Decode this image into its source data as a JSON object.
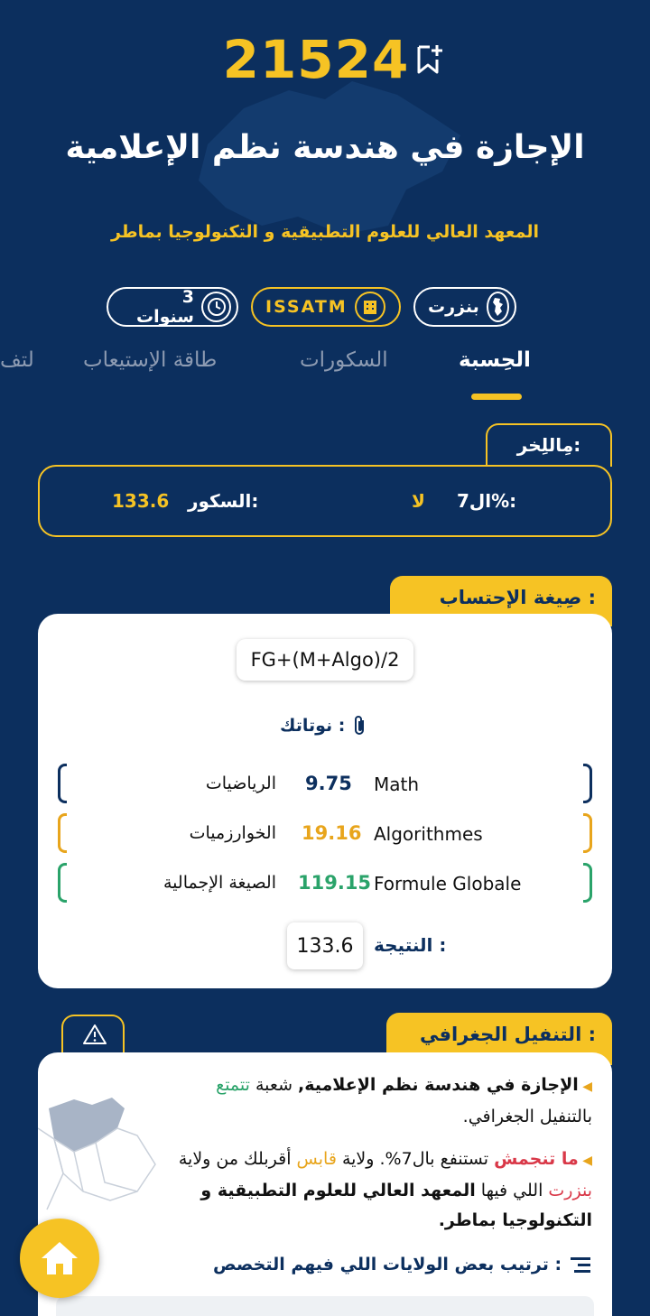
{
  "header": {
    "code": "21524",
    "title": "الإجازة في هندسة نظم الإعلامية",
    "institution": "المعهد العالي للعلوم التطبيقية و التكنولوجيا بماطر",
    "chips": {
      "governorate": "بنزرت",
      "institution_short": "ISSATM",
      "duration": "3 سنوات"
    }
  },
  "tabs": [
    "الحِسبة",
    "السكورات",
    "طاقة الإستيعاب",
    "التف"
  ],
  "filter": {
    "tag": "مِاللِخر:",
    "percent_label": "ال7%:",
    "percent_value": "لا",
    "score_label": "السكور:",
    "score_value": "133.6"
  },
  "formula": {
    "tag": "صِيغة الإحتساب :",
    "expression": "FG+(M+Algo)/2",
    "notes_label": "نوتاتك :",
    "rows": [
      {
        "fr": "Math",
        "value": "9.75",
        "ar": "الرياضيات",
        "color": "#0c2f5e"
      },
      {
        "fr": "Algorithmes",
        "value": "19.16",
        "ar": "الخوارزميات",
        "color": "#e8a51c"
      },
      {
        "fr": "Formule Globale",
        "value": "119.15",
        "ar": "الصيغة الإجمالية",
        "color": "#2aa36a"
      }
    ],
    "result_label": "النتيجة :",
    "result_value": "133.6"
  },
  "geo": {
    "tag": "التنفيل الجغرافي :",
    "p1_bold": "الإجازة في هندسة نظم الإعلامية,",
    "p1_mid": " شعبة ",
    "p1_green": "تتمتع",
    "p1_end": " بالتنفيل الجغرافي.",
    "p2_red": "ما تنجمش",
    "p2_a": " تستنفع بال7%. ولاية ",
    "p2_gold": "قابس",
    "p2_b": " أقربلك من ولاية ",
    "p2_red2": "بنزرت",
    "p2_c": " اللي فيها ",
    "p2_bold": "المعهد العالي للعلوم التطبيقية و التكنولوجيا بماطر.",
    "ranking_title": "ترتيب بعض الولايات اللي فيهم التخصص :"
  },
  "colors": {
    "background": "#0c2f5e",
    "accent": "#f6c324",
    "green": "#2aa36a",
    "red": "#d93848"
  }
}
